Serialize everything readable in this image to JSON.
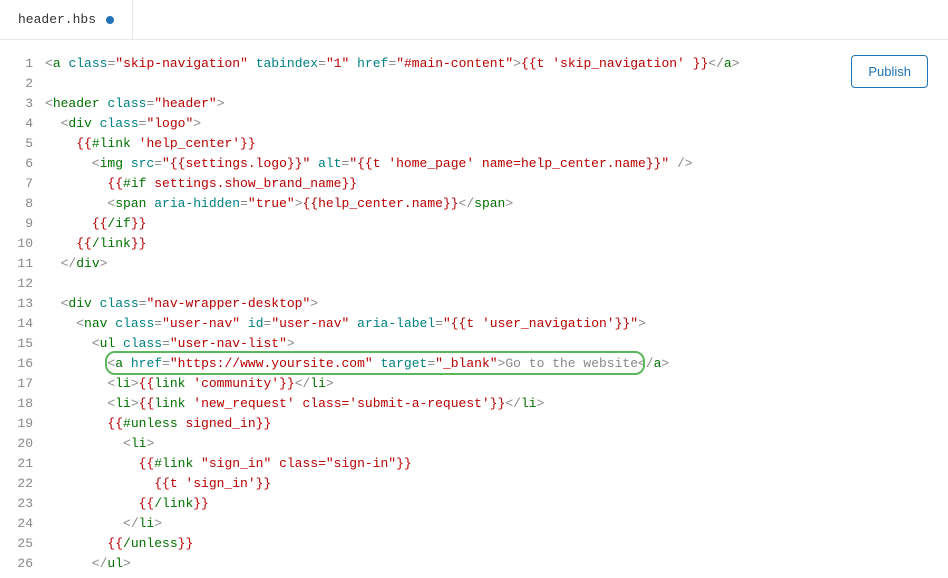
{
  "tab": {
    "filename": "header.hbs"
  },
  "publish_label": "Publish",
  "lines": [
    {
      "n": 1,
      "parts": [
        {
          "t": "text",
          "v": "<"
        },
        {
          "t": "tag",
          "v": "a"
        },
        {
          "t": "text",
          "v": " "
        },
        {
          "t": "attr",
          "v": "class"
        },
        {
          "t": "text",
          "v": "="
        },
        {
          "t": "str",
          "v": "\"skip-navigation\""
        },
        {
          "t": "text",
          "v": " "
        },
        {
          "t": "attr",
          "v": "tabindex"
        },
        {
          "t": "text",
          "v": "="
        },
        {
          "t": "str",
          "v": "\"1\""
        },
        {
          "t": "text",
          "v": " "
        },
        {
          "t": "attr",
          "v": "href"
        },
        {
          "t": "text",
          "v": "="
        },
        {
          "t": "str",
          "v": "\"#main-content\""
        },
        {
          "t": "text",
          "v": ">"
        },
        {
          "t": "hb",
          "v": "{{t 'skip_navigation' }}"
        },
        {
          "t": "text",
          "v": "</"
        },
        {
          "t": "tag",
          "v": "a"
        },
        {
          "t": "text",
          "v": ">"
        }
      ]
    },
    {
      "n": 2,
      "parts": []
    },
    {
      "n": 3,
      "parts": [
        {
          "t": "text",
          "v": "<"
        },
        {
          "t": "tag",
          "v": "header"
        },
        {
          "t": "text",
          "v": " "
        },
        {
          "t": "attr",
          "v": "class"
        },
        {
          "t": "text",
          "v": "="
        },
        {
          "t": "str",
          "v": "\"header\""
        },
        {
          "t": "text",
          "v": ">"
        }
      ]
    },
    {
      "n": 4,
      "parts": [
        {
          "t": "text",
          "v": "  <"
        },
        {
          "t": "tag",
          "v": "div"
        },
        {
          "t": "text",
          "v": " "
        },
        {
          "t": "attr",
          "v": "class"
        },
        {
          "t": "text",
          "v": "="
        },
        {
          "t": "str",
          "v": "\"logo\""
        },
        {
          "t": "text",
          "v": ">"
        }
      ]
    },
    {
      "n": 5,
      "parts": [
        {
          "t": "text",
          "v": "    "
        },
        {
          "t": "hb",
          "v": "{{"
        },
        {
          "t": "hbkw",
          "v": "#link"
        },
        {
          "t": "hb",
          "v": " 'help_center'}}"
        }
      ]
    },
    {
      "n": 6,
      "parts": [
        {
          "t": "text",
          "v": "      <"
        },
        {
          "t": "tag",
          "v": "img"
        },
        {
          "t": "text",
          "v": " "
        },
        {
          "t": "attr",
          "v": "src"
        },
        {
          "t": "text",
          "v": "="
        },
        {
          "t": "str",
          "v": "\"{{settings.logo}}\""
        },
        {
          "t": "text",
          "v": " "
        },
        {
          "t": "attr",
          "v": "alt"
        },
        {
          "t": "text",
          "v": "="
        },
        {
          "t": "str",
          "v": "\"{{t 'home_page' name=help_center.name}}\""
        },
        {
          "t": "text",
          "v": " />"
        }
      ]
    },
    {
      "n": 7,
      "parts": [
        {
          "t": "text",
          "v": "        "
        },
        {
          "t": "hb",
          "v": "{{"
        },
        {
          "t": "hbkw",
          "v": "#if"
        },
        {
          "t": "hb",
          "v": " settings.show_brand_name}}"
        }
      ]
    },
    {
      "n": 8,
      "parts": [
        {
          "t": "text",
          "v": "        <"
        },
        {
          "t": "tag",
          "v": "span"
        },
        {
          "t": "text",
          "v": " "
        },
        {
          "t": "attr",
          "v": "aria-hidden"
        },
        {
          "t": "text",
          "v": "="
        },
        {
          "t": "str",
          "v": "\"true\""
        },
        {
          "t": "text",
          "v": ">"
        },
        {
          "t": "hb",
          "v": "{{help_center.name}}"
        },
        {
          "t": "text",
          "v": "</"
        },
        {
          "t": "tag",
          "v": "span"
        },
        {
          "t": "text",
          "v": ">"
        }
      ]
    },
    {
      "n": 9,
      "parts": [
        {
          "t": "text",
          "v": "      "
        },
        {
          "t": "hb",
          "v": "{{"
        },
        {
          "t": "hbkw",
          "v": "/if"
        },
        {
          "t": "hb",
          "v": "}}"
        }
      ]
    },
    {
      "n": 10,
      "parts": [
        {
          "t": "text",
          "v": "    "
        },
        {
          "t": "hb",
          "v": "{{"
        },
        {
          "t": "hbkw",
          "v": "/link"
        },
        {
          "t": "hb",
          "v": "}}"
        }
      ]
    },
    {
      "n": 11,
      "parts": [
        {
          "t": "text",
          "v": "  </"
        },
        {
          "t": "tag",
          "v": "div"
        },
        {
          "t": "text",
          "v": ">"
        }
      ]
    },
    {
      "n": 12,
      "parts": []
    },
    {
      "n": 13,
      "parts": [
        {
          "t": "text",
          "v": "  <"
        },
        {
          "t": "tag",
          "v": "div"
        },
        {
          "t": "text",
          "v": " "
        },
        {
          "t": "attr",
          "v": "class"
        },
        {
          "t": "text",
          "v": "="
        },
        {
          "t": "str",
          "v": "\"nav-wrapper-desktop\""
        },
        {
          "t": "text",
          "v": ">"
        }
      ]
    },
    {
      "n": 14,
      "parts": [
        {
          "t": "text",
          "v": "    <"
        },
        {
          "t": "tag",
          "v": "nav"
        },
        {
          "t": "text",
          "v": " "
        },
        {
          "t": "attr",
          "v": "class"
        },
        {
          "t": "text",
          "v": "="
        },
        {
          "t": "str",
          "v": "\"user-nav\""
        },
        {
          "t": "text",
          "v": " "
        },
        {
          "t": "attr",
          "v": "id"
        },
        {
          "t": "text",
          "v": "="
        },
        {
          "t": "str",
          "v": "\"user-nav\""
        },
        {
          "t": "text",
          "v": " "
        },
        {
          "t": "attr",
          "v": "aria-label"
        },
        {
          "t": "text",
          "v": "="
        },
        {
          "t": "str",
          "v": "\"{{t 'user_navigation'}}\""
        },
        {
          "t": "text",
          "v": ">"
        }
      ]
    },
    {
      "n": 15,
      "parts": [
        {
          "t": "text",
          "v": "      <"
        },
        {
          "t": "tag",
          "v": "ul"
        },
        {
          "t": "text",
          "v": " "
        },
        {
          "t": "attr",
          "v": "class"
        },
        {
          "t": "text",
          "v": "="
        },
        {
          "t": "str",
          "v": "\"user-nav-list\""
        },
        {
          "t": "text",
          "v": ">"
        }
      ]
    },
    {
      "n": 16,
      "parts": [
        {
          "t": "text",
          "v": "        <"
        },
        {
          "t": "tag",
          "v": "a"
        },
        {
          "t": "text",
          "v": " "
        },
        {
          "t": "attr",
          "v": "href"
        },
        {
          "t": "text",
          "v": "="
        },
        {
          "t": "str",
          "v": "\"https://www.yoursite.com\""
        },
        {
          "t": "text",
          "v": " "
        },
        {
          "t": "attr",
          "v": "target"
        },
        {
          "t": "text",
          "v": "="
        },
        {
          "t": "str",
          "v": "\"_blank\""
        },
        {
          "t": "text",
          "v": ">Go to the website</"
        },
        {
          "t": "tag",
          "v": "a"
        },
        {
          "t": "text",
          "v": ">"
        }
      ]
    },
    {
      "n": 17,
      "parts": [
        {
          "t": "text",
          "v": "        <"
        },
        {
          "t": "tag",
          "v": "li"
        },
        {
          "t": "text",
          "v": ">"
        },
        {
          "t": "hb",
          "v": "{{"
        },
        {
          "t": "hbkw",
          "v": "link"
        },
        {
          "t": "hb",
          "v": " 'community'}}"
        },
        {
          "t": "text",
          "v": "</"
        },
        {
          "t": "tag",
          "v": "li"
        },
        {
          "t": "text",
          "v": ">"
        }
      ]
    },
    {
      "n": 18,
      "parts": [
        {
          "t": "text",
          "v": "        <"
        },
        {
          "t": "tag",
          "v": "li"
        },
        {
          "t": "text",
          "v": ">"
        },
        {
          "t": "hb",
          "v": "{{"
        },
        {
          "t": "hbkw",
          "v": "link"
        },
        {
          "t": "hb",
          "v": " 'new_request' class='submit-a-request'}}"
        },
        {
          "t": "text",
          "v": "</"
        },
        {
          "t": "tag",
          "v": "li"
        },
        {
          "t": "text",
          "v": ">"
        }
      ]
    },
    {
      "n": 19,
      "parts": [
        {
          "t": "text",
          "v": "        "
        },
        {
          "t": "hb",
          "v": "{{"
        },
        {
          "t": "hbkw",
          "v": "#unless"
        },
        {
          "t": "hb",
          "v": " signed_in}}"
        }
      ]
    },
    {
      "n": 20,
      "parts": [
        {
          "t": "text",
          "v": "          <"
        },
        {
          "t": "tag",
          "v": "li"
        },
        {
          "t": "text",
          "v": ">"
        }
      ]
    },
    {
      "n": 21,
      "parts": [
        {
          "t": "text",
          "v": "            "
        },
        {
          "t": "hb",
          "v": "{{"
        },
        {
          "t": "hbkw",
          "v": "#link"
        },
        {
          "t": "hb",
          "v": " \"sign_in\" class=\"sign-in\"}}"
        }
      ]
    },
    {
      "n": 22,
      "parts": [
        {
          "t": "text",
          "v": "              "
        },
        {
          "t": "hb",
          "v": "{{t 'sign_in'}}"
        }
      ]
    },
    {
      "n": 23,
      "parts": [
        {
          "t": "text",
          "v": "            "
        },
        {
          "t": "hb",
          "v": "{{"
        },
        {
          "t": "hbkw",
          "v": "/link"
        },
        {
          "t": "hb",
          "v": "}}"
        }
      ]
    },
    {
      "n": 24,
      "parts": [
        {
          "t": "text",
          "v": "          </"
        },
        {
          "t": "tag",
          "v": "li"
        },
        {
          "t": "text",
          "v": ">"
        }
      ]
    },
    {
      "n": 25,
      "parts": [
        {
          "t": "text",
          "v": "        "
        },
        {
          "t": "hb",
          "v": "{{"
        },
        {
          "t": "hbkw",
          "v": "/unless"
        },
        {
          "t": "hb",
          "v": "}}"
        }
      ]
    },
    {
      "n": 26,
      "parts": [
        {
          "t": "text",
          "v": "      </"
        },
        {
          "t": "tag",
          "v": "ul"
        },
        {
          "t": "text",
          "v": ">"
        }
      ]
    }
  ],
  "highlight": {
    "line": 16
  }
}
